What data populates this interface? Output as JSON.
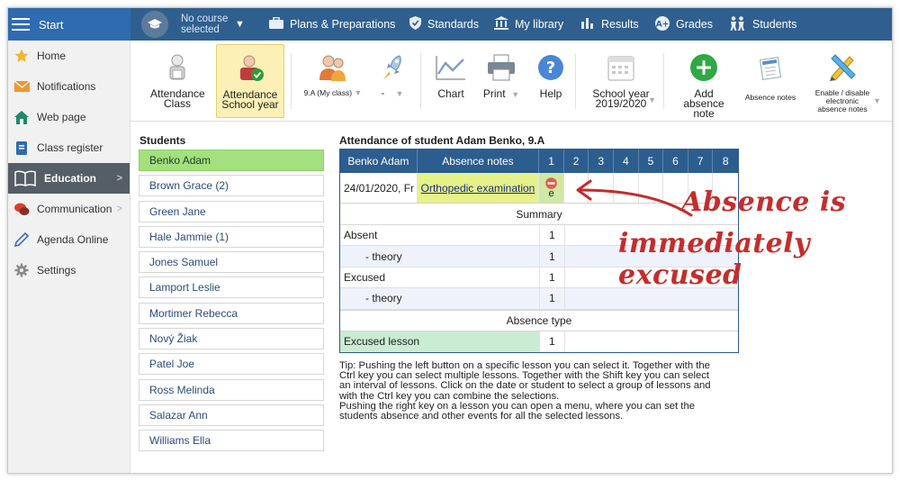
{
  "topbar": {
    "start_label": "Start",
    "course_label": "No course selected",
    "menu": [
      {
        "label": "Plans & Preparations",
        "icon": "briefcase-icon"
      },
      {
        "label": "Standards",
        "icon": "shield-icon"
      },
      {
        "label": "My library",
        "icon": "library-icon"
      },
      {
        "label": "Results",
        "icon": "bar-chart-icon"
      },
      {
        "label": "Grades",
        "icon": "grades-icon"
      },
      {
        "label": "Students",
        "icon": "students-icon"
      }
    ]
  },
  "sidebar": {
    "items": [
      {
        "label": "Home",
        "icon": "star-icon"
      },
      {
        "label": "Notifications",
        "icon": "envelope-icon"
      },
      {
        "label": "Web page",
        "icon": "house-icon"
      },
      {
        "label": "Class register",
        "icon": "register-icon"
      },
      {
        "label": "Education",
        "icon": "book-icon",
        "active": true
      },
      {
        "label": "Communication",
        "icon": "chat-icon"
      },
      {
        "label": "Agenda Online",
        "icon": "pen-icon"
      },
      {
        "label": "Settings",
        "icon": "gear-icon"
      }
    ]
  },
  "toolbar": {
    "attendance_class": "Attendance Class",
    "attendance_year": "Attendance School year",
    "class_select": "9.A (My class)",
    "dash_select": "-",
    "chart": "Chart",
    "print": "Print",
    "help": "Help",
    "school_year": "School year 2019/2020",
    "add_absence_note": "Add absence note",
    "absence_notes": "Absence notes",
    "enable_electronic": "Enable / disable electronic absence notes"
  },
  "students": {
    "title": "Students",
    "list": [
      "Benko Adam",
      "Brown Grace (2)",
      "Green Jane",
      "Hale Jammie (1)",
      "Jones Samuel",
      "Lamport Leslie",
      "Mortimer Rebecca",
      "Nový Žiak",
      "Patel Joe",
      "Ross Melinda",
      "Salazar Ann",
      "Williams Ella"
    ]
  },
  "attendance": {
    "title": "Attendance of student Adam Benko, 9.A",
    "header": {
      "student": "Benko Adam",
      "notes": "Absence notes",
      "lessons": [
        "1",
        "2",
        "3",
        "4",
        "5",
        "6",
        "7",
        "8"
      ]
    },
    "row": {
      "date": "24/01/2020, Fr",
      "note": "Orthopedic examination",
      "mark": "e"
    },
    "summary_label": "Summary",
    "summary": [
      {
        "label": "Absent",
        "value": "1"
      },
      {
        "label": "- theory",
        "value": "1"
      },
      {
        "label": "Excused",
        "value": "1"
      },
      {
        "label": "- theory",
        "value": "1"
      }
    ],
    "type_label": "Absence type",
    "type_rows": [
      {
        "label": "Excused lesson",
        "value": "1"
      }
    ]
  },
  "tip": {
    "p1": "Tip: Pushing the left button on a specific lesson you can select it. Together with the Ctrl key you can select multiple lessons. Together with the Shift key you can select an interval of lessons. Click on the date or student to select a group of lessons and with the Ctrl key you can combine the selections.",
    "p2": "Pushing the right key on a lesson you can open a menu, where you can set the students absence and other events for all the selected lessons."
  },
  "annotation": {
    "line1": "Absence is",
    "line2": "immediately excused",
    "color": "#c62c2c"
  }
}
